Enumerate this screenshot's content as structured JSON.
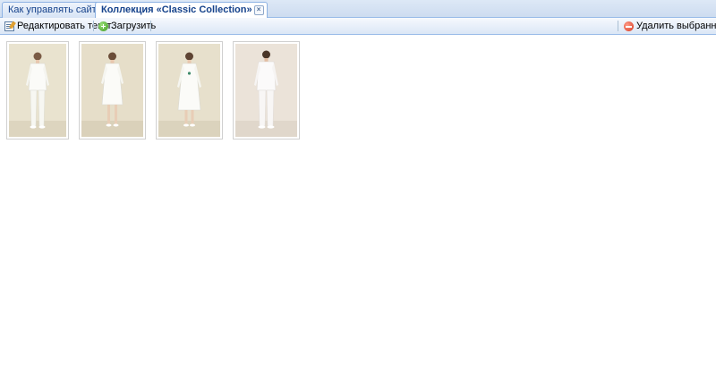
{
  "tabs": [
    {
      "label": "Как управлять сайтом",
      "active": false
    },
    {
      "label": "Коллекция «Classic Collection»",
      "active": true
    }
  ],
  "toolbar": {
    "edit_label": "Редактировать текст",
    "upload_label": "Загрузить",
    "delete_label": "Удалить выбранные"
  },
  "gallery": {
    "items": [
      {
        "icon": "photo-woman-pantsuit"
      },
      {
        "icon": "photo-woman-dress"
      },
      {
        "icon": "photo-woman-coat"
      },
      {
        "icon": "photo-man-suit"
      }
    ]
  },
  "colors": {
    "accent": "#15428b",
    "border": "#99bbe8",
    "photo_bg": "#e4dcc8"
  }
}
